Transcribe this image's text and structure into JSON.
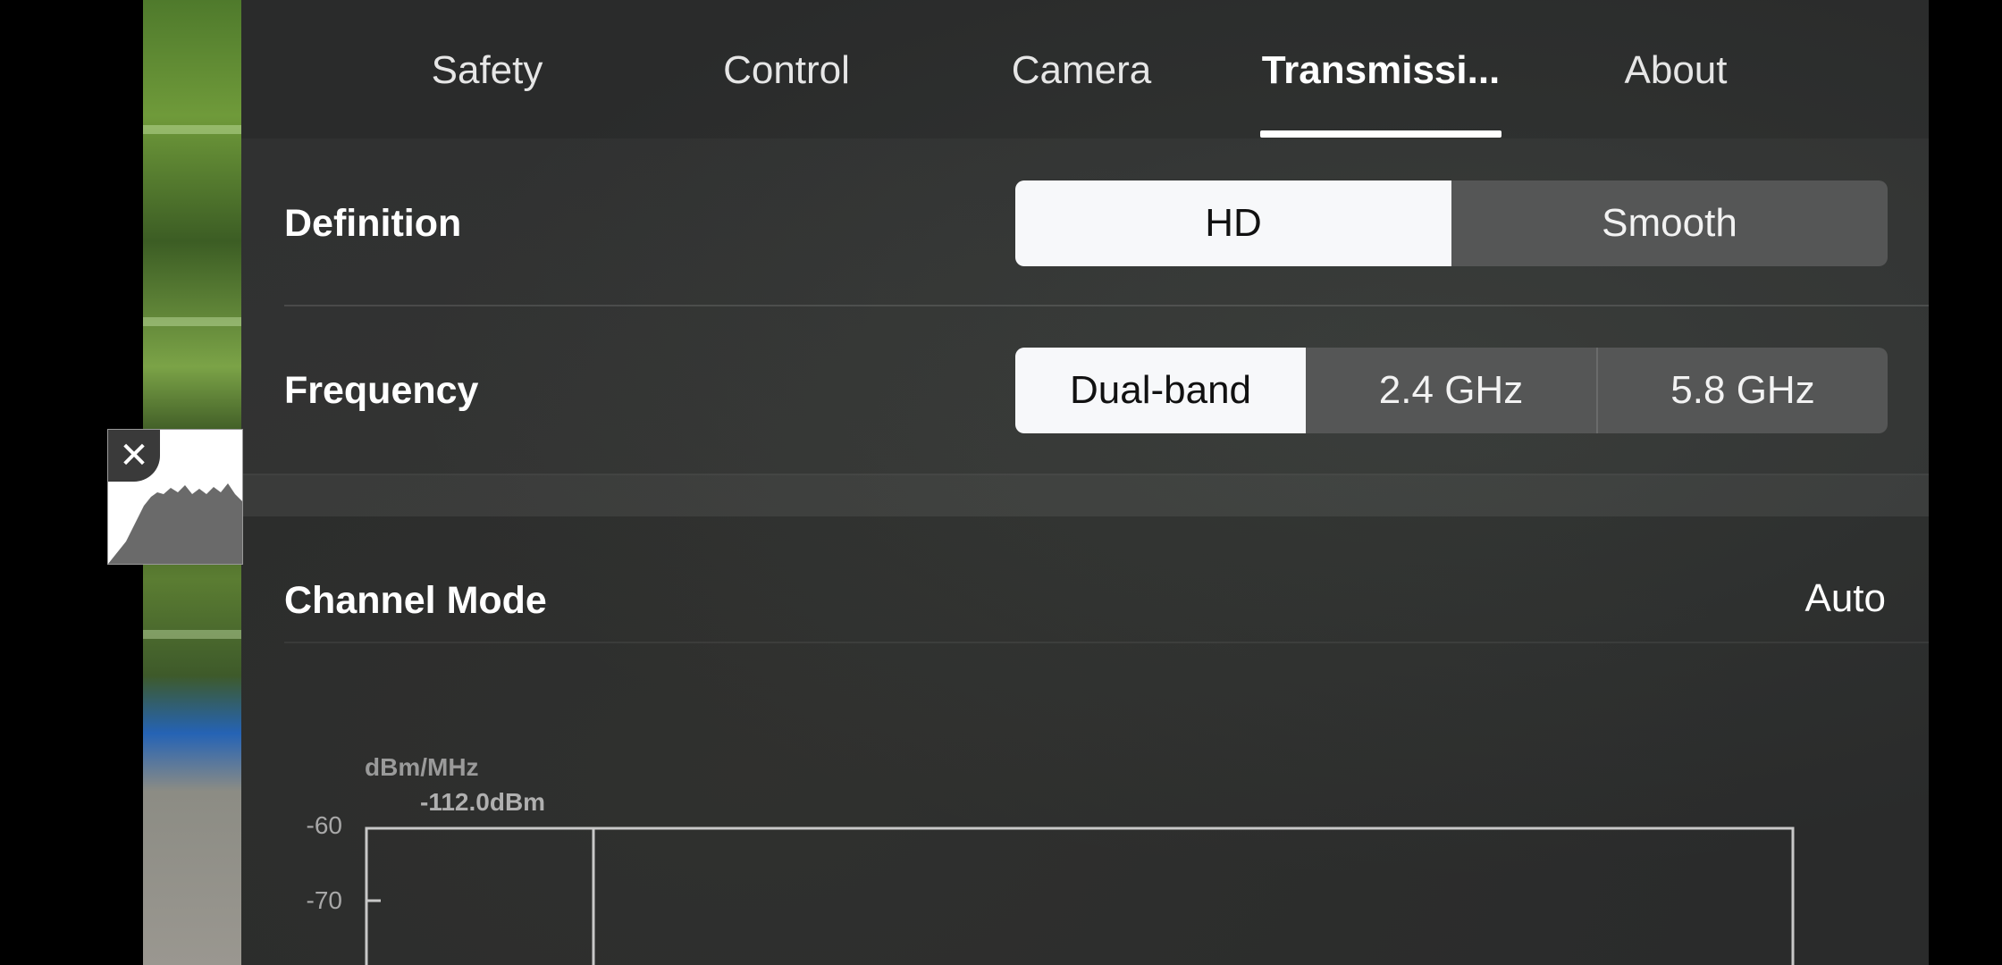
{
  "tabs": [
    {
      "label": "Safety"
    },
    {
      "label": "Control"
    },
    {
      "label": "Camera"
    },
    {
      "label": "Transmissi..."
    },
    {
      "label": "About"
    }
  ],
  "active_tab": "Transmissi...",
  "definition": {
    "label": "Definition",
    "options": [
      "HD",
      "Smooth"
    ],
    "selected": "HD"
  },
  "frequency": {
    "label": "Frequency",
    "options": [
      "Dual-band",
      "2.4 GHz",
      "5.8 GHz"
    ],
    "selected": "Dual-band"
  },
  "channel_mode": {
    "label": "Channel Mode",
    "value": "Auto"
  },
  "spectrum_chart": {
    "unit": "dBm/MHz",
    "peak_label": "-112.0dBm",
    "y_ticks": [
      "-60",
      "-70"
    ]
  },
  "histogram": {
    "close_icon": "close-icon"
  },
  "colors": {
    "panel_bg": "#2a2b2b",
    "selected_segment": "#f7f8fa",
    "segment_bg": "#555656"
  }
}
